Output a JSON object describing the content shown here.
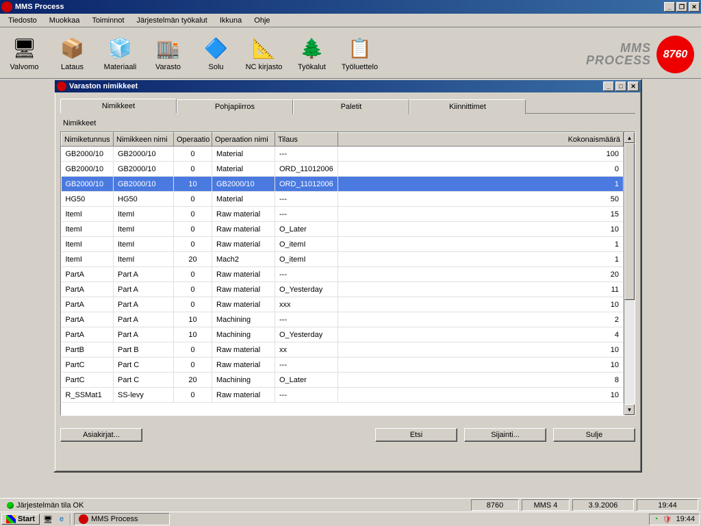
{
  "window": {
    "title": "MMS Process",
    "menu": [
      "Tiedosto",
      "Muokkaa",
      "Toiminnot",
      "Järjestelmän työkalut",
      "Ikkuna",
      "Ohje"
    ],
    "toolbar": [
      {
        "label": "Valvomo"
      },
      {
        "label": "Lataus"
      },
      {
        "label": "Materiaali"
      },
      {
        "label": "Varasto"
      },
      {
        "label": "Solu"
      },
      {
        "label": "NC kirjasto"
      },
      {
        "label": "Työkalut"
      },
      {
        "label": "Työluettelo"
      }
    ],
    "brand": {
      "line1": "MMS",
      "line2": "PROCESS",
      "badge": "8760"
    }
  },
  "child": {
    "title": "Varaston nimikkeet",
    "tabs": [
      "Nimikkeet",
      "Pohjapiirros",
      "Paletit",
      "Kiinnittimet"
    ],
    "active_tab": 0,
    "section_label": "Nimikkeet",
    "columns": [
      "Nimiketunnus",
      "Nimikkeen nimi",
      "Operaatio",
      "Operaation nimi",
      "Tilaus",
      "Kokonaismäärä"
    ],
    "selected_row": 2,
    "rows": [
      [
        "GB2000/10",
        "GB2000/10",
        "0",
        "Material",
        "---",
        "100"
      ],
      [
        "GB2000/10",
        "GB2000/10",
        "0",
        "Material",
        "ORD_11012006",
        "0"
      ],
      [
        "GB2000/10",
        "GB2000/10",
        "10",
        "GB2000/10",
        "ORD_11012006",
        "1"
      ],
      [
        "HG50",
        "HG50",
        "0",
        "Material",
        "---",
        "50"
      ],
      [
        "ItemI",
        "ItemI",
        "0",
        "Raw material",
        "---",
        "15"
      ],
      [
        "ItemI",
        "ItemI",
        "0",
        "Raw material",
        "O_Later",
        "10"
      ],
      [
        "ItemI",
        "ItemI",
        "0",
        "Raw material",
        "O_itemI",
        "1"
      ],
      [
        "ItemI",
        "ItemI",
        "20",
        "Mach2",
        "O_itemI",
        "1"
      ],
      [
        "PartA",
        "Part A",
        "0",
        "Raw material",
        "---",
        "20"
      ],
      [
        "PartA",
        "Part A",
        "0",
        "Raw material",
        "O_Yesterday",
        "11"
      ],
      [
        "PartA",
        "Part A",
        "0",
        "Raw material",
        "xxx",
        "10"
      ],
      [
        "PartA",
        "Part A",
        "10",
        "Machining",
        "---",
        "2"
      ],
      [
        "PartA",
        "Part A",
        "10",
        "Machining",
        "O_Yesterday",
        "4"
      ],
      [
        "PartB",
        "Part B",
        "0",
        "Raw material",
        "xx",
        "10"
      ],
      [
        "PartC",
        "Part C",
        "0",
        "Raw material",
        "---",
        "10"
      ],
      [
        "PartC",
        "Part C",
        "20",
        "Machining",
        "O_Later",
        "8"
      ],
      [
        "R_SSMat1",
        "SS-levy",
        "0",
        "Raw material",
        "---",
        "10"
      ]
    ],
    "buttons": {
      "asiakirjat": "Asiakirjat...",
      "etsi": "Etsi",
      "sijainti": "Sijainti...",
      "sulje": "Sulje"
    }
  },
  "statusbar": {
    "system": "Järjestelmän tila OK",
    "code": "8760",
    "mms": "MMS 4",
    "date": "3.9.2006",
    "time": "19:44"
  },
  "taskbar": {
    "start": "Start",
    "active_task": "MMS Process",
    "tray_time": "19:44"
  }
}
